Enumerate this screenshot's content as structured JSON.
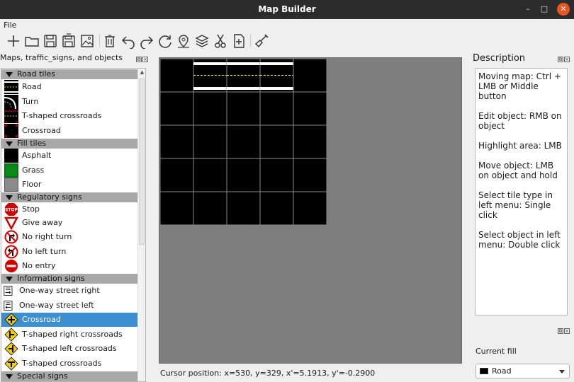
{
  "window": {
    "title": "Map Builder",
    "minimize": "–",
    "maximize": "□",
    "close": "✕"
  },
  "menu": {
    "file": "File"
  },
  "toolbar": {
    "buttons": [
      "new-map-icon",
      "open-folder-icon",
      "save-icon",
      "save-as-icon",
      "export-image-icon",
      "delete-icon",
      "undo-icon",
      "redo-icon",
      "rotate-icon",
      "pin-icon",
      "layers-icon",
      "cut-icon",
      "add-object-icon",
      "brush-icon"
    ]
  },
  "left_dock": {
    "title": "Maps, traffic_signs, and objects",
    "categories": {
      "road_tiles": "Road tiles",
      "fill_tiles": "Fill tiles",
      "regulatory_signs": "Regulatory signs",
      "information_signs": "Information signs",
      "special_signs": "Special signs"
    },
    "items": {
      "road": "Road",
      "turn": "Turn",
      "t_crossroads": "T-shaped crossroads",
      "crossroad": "Crossroad",
      "asphalt": "Asphalt",
      "grass": "Grass",
      "floor": "Floor",
      "stop": "Stop",
      "give_away": "Give away",
      "no_right_turn": "No right turn",
      "no_left_turn": "No left turn",
      "no_entry": "No entry",
      "one_way_right": "One-way street right",
      "one_way_left": "One-way street left",
      "info_crossroad": "Crossroad",
      "t_right": "T-shaped right crossroads",
      "t_left": "T-shaped left crossroads",
      "t_shaped": "T-shaped crossroads"
    },
    "selected": "info_crossroad"
  },
  "map": {
    "columns": 5,
    "rows": 5,
    "tiles": [
      [
        "asphalt",
        "road",
        "road",
        "road",
        "asphalt"
      ],
      [
        "asphalt",
        "asphalt",
        "asphalt",
        "asphalt",
        "asphalt"
      ],
      [
        "asphalt",
        "asphalt",
        "asphalt",
        "asphalt",
        "asphalt"
      ],
      [
        "asphalt",
        "asphalt",
        "asphalt",
        "asphalt",
        "asphalt"
      ],
      [
        "asphalt",
        "asphalt",
        "asphalt",
        "asphalt",
        "asphalt"
      ]
    ],
    "colors": {
      "asphalt": "#000000",
      "road_edge": "#ffffff",
      "lane": "#f5e000",
      "grid": "#8a8a8a",
      "background": "#7e7e7e"
    }
  },
  "status": {
    "cursor": "Cursor position: x=530, y=329, x'=5.1913, y'=-0.2900"
  },
  "description": {
    "title": "Description",
    "lines": [
      "Moving map: Ctrl + LMB or Middle button",
      "Edit object: RMB on object",
      "Highlight area: LMB",
      "Move object: LMB on object and hold",
      "Select tile type in left menu: Single click",
      "Select object in left menu: Double click"
    ]
  },
  "fill": {
    "label": "Current fill",
    "value": "Road"
  },
  "colors": {
    "selection": "#3d8fd1",
    "category_bg": "#a8a8a8",
    "titlebar": "#2c2c2c",
    "close": "#e95420"
  }
}
